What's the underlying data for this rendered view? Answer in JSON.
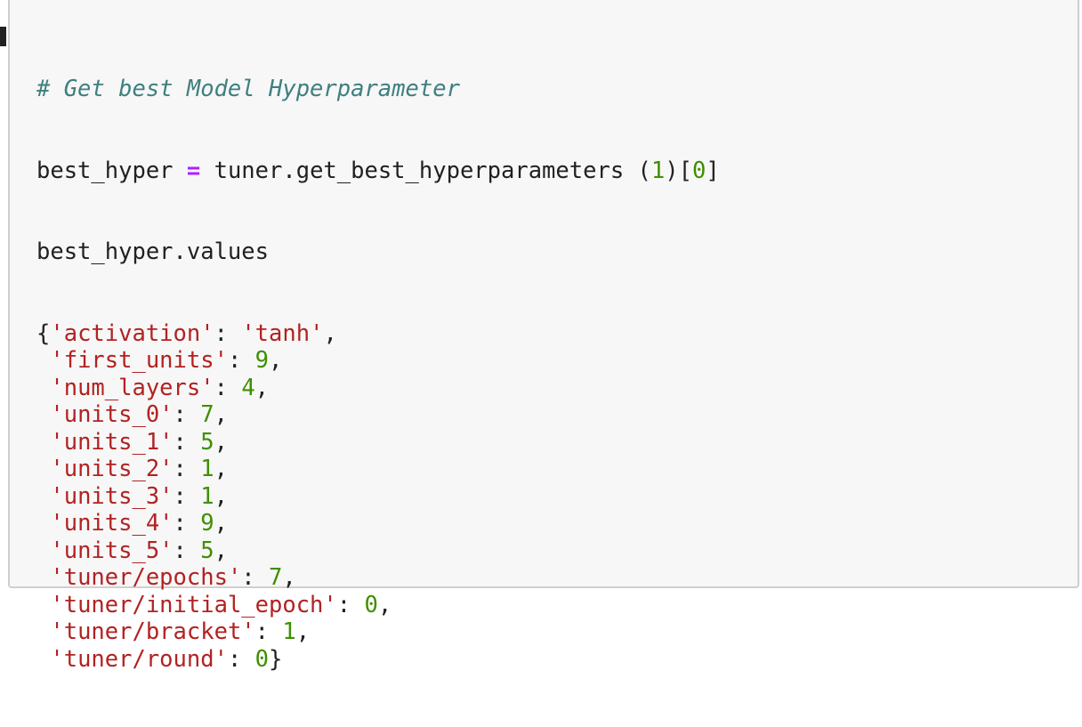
{
  "code_cell": {
    "comment": "# Get best Model Hyperparameter",
    "line2": {
      "var": "best_hyper ",
      "op": "=",
      "call": " tuner.get_best_hyperparameters (",
      "arg": "1",
      "mid": ")[",
      "idx": "0",
      "end": "]"
    },
    "line3": "best_hyper.values"
  },
  "output": {
    "entries": [
      {
        "prefix": "{",
        "key": "'activation'",
        "sep": ": ",
        "value": "'tanh'",
        "value_type": "str",
        "suffix": ","
      },
      {
        "prefix": " ",
        "key": "'first_units'",
        "sep": ": ",
        "value": "9",
        "value_type": "num",
        "suffix": ","
      },
      {
        "prefix": " ",
        "key": "'num_layers'",
        "sep": ": ",
        "value": "4",
        "value_type": "num",
        "suffix": ","
      },
      {
        "prefix": " ",
        "key": "'units_0'",
        "sep": ": ",
        "value": "7",
        "value_type": "num",
        "suffix": ","
      },
      {
        "prefix": " ",
        "key": "'units_1'",
        "sep": ": ",
        "value": "5",
        "value_type": "num",
        "suffix": ","
      },
      {
        "prefix": " ",
        "key": "'units_2'",
        "sep": ": ",
        "value": "1",
        "value_type": "num",
        "suffix": ","
      },
      {
        "prefix": " ",
        "key": "'units_3'",
        "sep": ": ",
        "value": "1",
        "value_type": "num",
        "suffix": ","
      },
      {
        "prefix": " ",
        "key": "'units_4'",
        "sep": ": ",
        "value": "9",
        "value_type": "num",
        "suffix": ","
      },
      {
        "prefix": " ",
        "key": "'units_5'",
        "sep": ": ",
        "value": "5",
        "value_type": "num",
        "suffix": ","
      },
      {
        "prefix": " ",
        "key": "'tuner/epochs'",
        "sep": ": ",
        "value": "7",
        "value_type": "num",
        "suffix": ","
      },
      {
        "prefix": " ",
        "key": "'tuner/initial_epoch'",
        "sep": ": ",
        "value": "0",
        "value_type": "num",
        "suffix": ","
      },
      {
        "prefix": " ",
        "key": "'tuner/bracket'",
        "sep": ": ",
        "value": "1",
        "value_type": "num",
        "suffix": ","
      },
      {
        "prefix": " ",
        "key": "'tuner/round'",
        "sep": ": ",
        "value": "0",
        "value_type": "num",
        "suffix": "}"
      }
    ]
  },
  "colors": {
    "comment": "#3f7f7f",
    "operator": "#aa22ff",
    "number": "#3f8f00",
    "string": "#b22222",
    "text": "#212121",
    "cell_background": "#f7f7f7",
    "cell_border": "#cfcfcf"
  }
}
